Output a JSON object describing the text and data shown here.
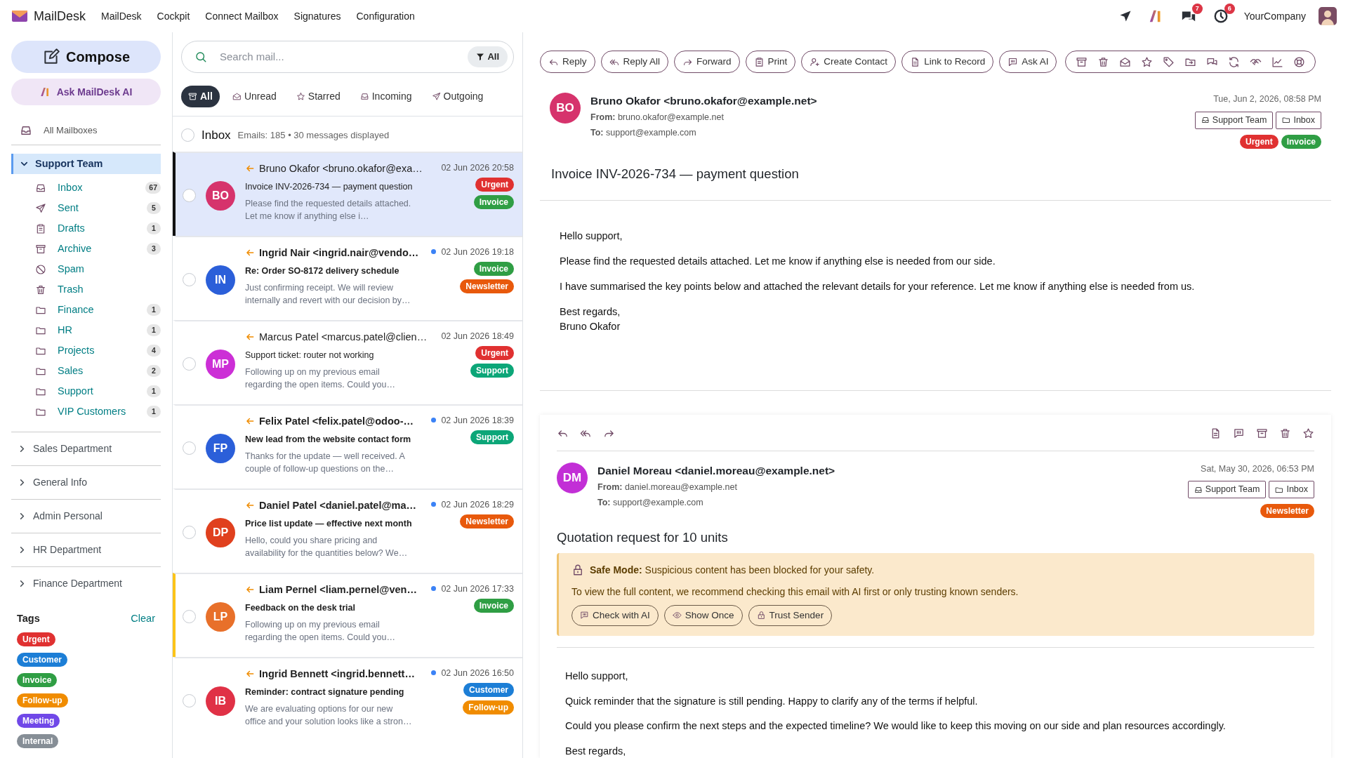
{
  "topbar": {
    "brand": "MailDesk",
    "menu": [
      "MailDesk",
      "Cockpit",
      "Connect Mailbox",
      "Signatures",
      "Configuration"
    ],
    "notifications": [
      {
        "count": "7"
      },
      {
        "count": "6"
      }
    ],
    "company": "YourCompany"
  },
  "sidebar": {
    "compose": "Compose",
    "ask_ai": "Ask MailDesk AI",
    "all_mailboxes": "All Mailboxes",
    "accounts": [
      {
        "name": "Support Team",
        "expanded": true,
        "selected": true,
        "folders": [
          {
            "kind": "inbox",
            "name": "Inbox",
            "count": "67"
          },
          {
            "kind": "sent",
            "name": "Sent",
            "count": "5"
          },
          {
            "kind": "drafts",
            "name": "Drafts",
            "count": "1"
          },
          {
            "kind": "archive",
            "name": "Archive",
            "count": "3"
          },
          {
            "kind": "spam",
            "name": "Spam"
          },
          {
            "kind": "trash",
            "name": "Trash"
          },
          {
            "kind": "folder",
            "name": "Finance",
            "count": "1"
          },
          {
            "kind": "folder",
            "name": "HR",
            "count": "1"
          },
          {
            "kind": "folder",
            "name": "Projects",
            "count": "4"
          },
          {
            "kind": "folder",
            "name": "Sales",
            "count": "2"
          },
          {
            "kind": "folder",
            "name": "Support",
            "count": "1"
          },
          {
            "kind": "folder",
            "name": "VIP Customers",
            "count": "1"
          }
        ]
      },
      {
        "name": "Sales Department",
        "expanded": false,
        "selected": false
      },
      {
        "name": "General Info",
        "expanded": false,
        "selected": false
      },
      {
        "name": "Admin Personal",
        "expanded": false,
        "selected": false
      },
      {
        "name": "HR Department",
        "expanded": false,
        "selected": false
      },
      {
        "name": "Finance Department",
        "expanded": false,
        "selected": false
      }
    ],
    "tags_title": "Tags",
    "tags_clear": "Clear",
    "tags": [
      {
        "label": "Urgent",
        "color": "#e03131"
      },
      {
        "label": "Customer",
        "color": "#1c7ed6"
      },
      {
        "label": "Invoice",
        "color": "#2f9e44"
      },
      {
        "label": "Follow-up",
        "color": "#f08c00"
      },
      {
        "label": "Meeting",
        "color": "#7048e8"
      },
      {
        "label": "Internal",
        "color": "#868e96"
      }
    ]
  },
  "mail_list": {
    "search": {
      "placeholder": "Search mail..."
    },
    "filter": "All",
    "tabs": [
      {
        "label": "All",
        "selected": true
      },
      {
        "label": "Unread",
        "selected": false
      },
      {
        "label": "Starred",
        "selected": false
      },
      {
        "label": "Incoming",
        "selected": false
      },
      {
        "label": "Outgoing",
        "selected": false
      }
    ],
    "select_all_checked": false,
    "folder_title": "Inbox",
    "summary": "Emails: 185 • 30 messages displayed",
    "messages": [
      {
        "initials": "BO",
        "color": "#d6336c",
        "sender": "Bruno Okafor <bruno.okafor@exa…",
        "date": "02 Jun 2026 20:58",
        "subject": "Invoice INV-2026-734 — payment question",
        "preview": "Please find the requested details attached. Let me know if anything else i…",
        "unread": false,
        "selected": true,
        "starred": false,
        "checked": false,
        "tags": [
          {
            "label": "Urgent",
            "color": "#e03131"
          },
          {
            "label": "Invoice",
            "color": "#2f9e44"
          }
        ]
      },
      {
        "initials": "IN",
        "color": "#2b5fd9",
        "sender": "Ingrid Nair <ingrid.nair@vendo…",
        "date": "02 Jun 2026 19:18",
        "subject": "Re: Order SO-8172 delivery schedule",
        "preview": "Just confirming receipt. We will review internally and revert with our decision by…",
        "unread": true,
        "selected": false,
        "starred": false,
        "checked": false,
        "tags": [
          {
            "label": "Invoice",
            "color": "#2f9e44"
          },
          {
            "label": "Newsletter",
            "color": "#e8590c"
          }
        ]
      },
      {
        "initials": "MP",
        "color": "#cc2fd6",
        "sender": "Marcus Patel <marcus.patel@clien…",
        "date": "02 Jun 2026 18:49",
        "subject": "Support ticket: router not working",
        "preview": "Following up on my previous email regarding the open items. Could you…",
        "unread": false,
        "selected": false,
        "starred": false,
        "checked": false,
        "tags": [
          {
            "label": "Urgent",
            "color": "#e03131"
          },
          {
            "label": "Support",
            "color": "#0ca678"
          }
        ]
      },
      {
        "initials": "FP",
        "color": "#2b5fd9",
        "sender": "Felix Patel <felix.patel@odoo-…",
        "date": "02 Jun 2026 18:39",
        "subject": "New lead from the website contact form",
        "preview": "Thanks for the update — well received. A couple of follow-up questions on the…",
        "unread": true,
        "selected": false,
        "starred": false,
        "checked": false,
        "tags": [
          {
            "label": "Support",
            "color": "#0ca678"
          }
        ]
      },
      {
        "initials": "DP",
        "color": "#e0401e",
        "sender": "Daniel Patel <daniel.patel@ma…",
        "date": "02 Jun 2026 18:29",
        "subject": "Price list update — effective next month",
        "preview": "Hello, could you share pricing and availability for the quantities below? We…",
        "unread": true,
        "selected": false,
        "starred": false,
        "checked": false,
        "tags": [
          {
            "label": "Newsletter",
            "color": "#e8590c"
          }
        ]
      },
      {
        "initials": "LP",
        "color": "#e8702a",
        "sender": "Liam Pernel <liam.pernel@ven…",
        "date": "02 Jun 2026 17:33",
        "subject": "Feedback on the desk trial",
        "preview": "Following up on my previous email regarding the open items. Could you…",
        "unread": true,
        "selected": false,
        "starred": true,
        "checked": false,
        "tags": [
          {
            "label": "Invoice",
            "color": "#2f9e44"
          }
        ]
      },
      {
        "initials": "IB",
        "color": "#e03146",
        "sender": "Ingrid Bennett <ingrid.bennett…",
        "date": "02 Jun 2026 16:50",
        "subject": "Reminder: contract signature pending",
        "preview": "We are evaluating options for our new office and your solution looks like a stron…",
        "unread": true,
        "selected": false,
        "starred": false,
        "checked": false,
        "tags": [
          {
            "label": "Customer",
            "color": "#1c7ed6"
          },
          {
            "label": "Follow-up",
            "color": "#f08c00"
          }
        ]
      }
    ]
  },
  "reader": {
    "toolbar": [
      "Reply",
      "Reply All",
      "Forward",
      "Print",
      "Create Contact",
      "Link to Record",
      "Ask AI"
    ],
    "thread": [
      {
        "kind": "primary",
        "initials": "BO",
        "color": "#d6336c",
        "sender": "Bruno Okafor <bruno.okafor@example.net>",
        "from": "**From:** bruno.okafor@example.net",
        "to": "**To:** support@example.com",
        "date": "Tue, Jun 2, 2026, 08:58 PM",
        "folders": [
          "Support Team",
          "Inbox"
        ],
        "tags": [
          {
            "label": "Urgent",
            "color": "#e03131"
          },
          {
            "label": "Invoice",
            "color": "#2f9e44"
          }
        ],
        "subject": "Invoice INV-2026-734 — payment question",
        "body": [
          "Hello support,",
          "Please find the requested details attached. Let me know if anything else is needed from our side.",
          "I have summarised the key points below and attached the relevant details for your reference. Let me know if anything else is needed from us."
        ],
        "signoff": [
          "Best regards,",
          "Bruno Okafor"
        ]
      },
      {
        "kind": "card",
        "initials": "DM",
        "color": "#c22fd6",
        "sender": "Daniel Moreau <daniel.moreau@example.net>",
        "from": "**From:** daniel.moreau@example.net",
        "to": "**To:** support@example.com",
        "date": "Sat, May 30, 2026, 06:53 PM",
        "folders": [
          "Support Team",
          "Inbox"
        ],
        "tags": [
          {
            "label": "Newsletter",
            "color": "#e8590c"
          }
        ],
        "subject": "Quotation request for 10 units",
        "alert": {
          "text": "**Safe Mode:** Suspicious content has been blocked for your safety.",
          "detail": "To view the full content, we recommend checking this email with AI first or only trusting known senders.",
          "buttons": [
            "Check with AI",
            "Show Once",
            "Trust Sender"
          ]
        },
        "body": [
          "Hello support,",
          "Quick reminder that the signature is still pending. Happy to clarify any of the terms if helpful.",
          "Could you please confirm the next steps and the expected timeline? We would like to keep this moving on our side and plan resources accordingly."
        ],
        "signoff": [
          "Best regards,"
        ]
      }
    ]
  }
}
